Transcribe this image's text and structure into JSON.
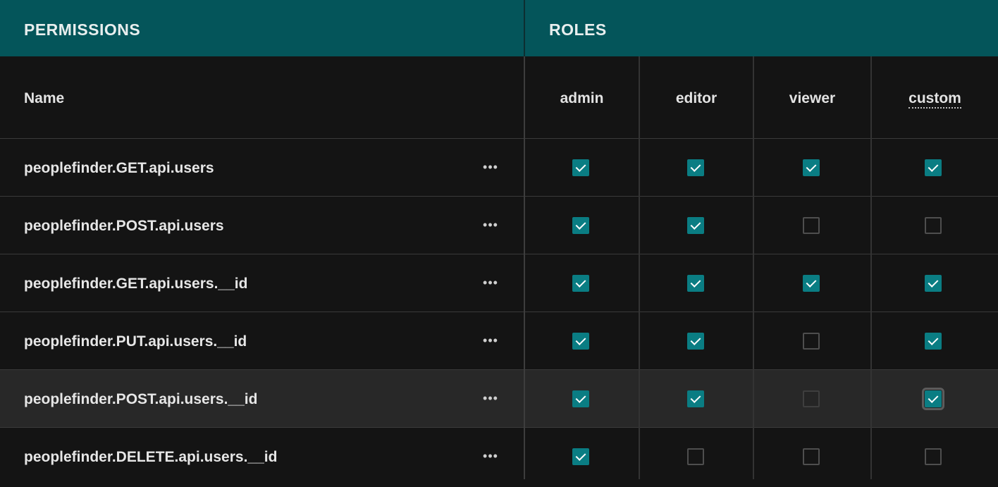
{
  "header": {
    "permissions_label": "PERMISSIONS",
    "roles_label": "ROLES"
  },
  "columns": {
    "name_label": "Name",
    "roles": [
      "admin",
      "editor",
      "viewer",
      "custom"
    ]
  },
  "row_menu_icon": "more-horizontal-icon",
  "rows": [
    {
      "name": "peoplefinder.GET.api.users",
      "admin": true,
      "editor": true,
      "viewer": true,
      "custom": true
    },
    {
      "name": "peoplefinder.POST.api.users",
      "admin": true,
      "editor": true,
      "viewer": false,
      "custom": false
    },
    {
      "name": "peoplefinder.GET.api.users.__id",
      "admin": true,
      "editor": true,
      "viewer": true,
      "custom": true
    },
    {
      "name": "peoplefinder.PUT.api.users.__id",
      "admin": true,
      "editor": true,
      "viewer": false,
      "custom": true
    },
    {
      "name": "peoplefinder.POST.api.users.__id",
      "admin": true,
      "editor": true,
      "viewer": false,
      "custom": true
    },
    {
      "name": "peoplefinder.DELETE.api.users.__id",
      "admin": true,
      "editor": false,
      "viewer": false,
      "custom": false
    }
  ],
  "colors": {
    "header_band": "#04555a",
    "checkbox_checked": "#0a7d83",
    "background": "#131313",
    "highlighted_row": "#282828"
  }
}
